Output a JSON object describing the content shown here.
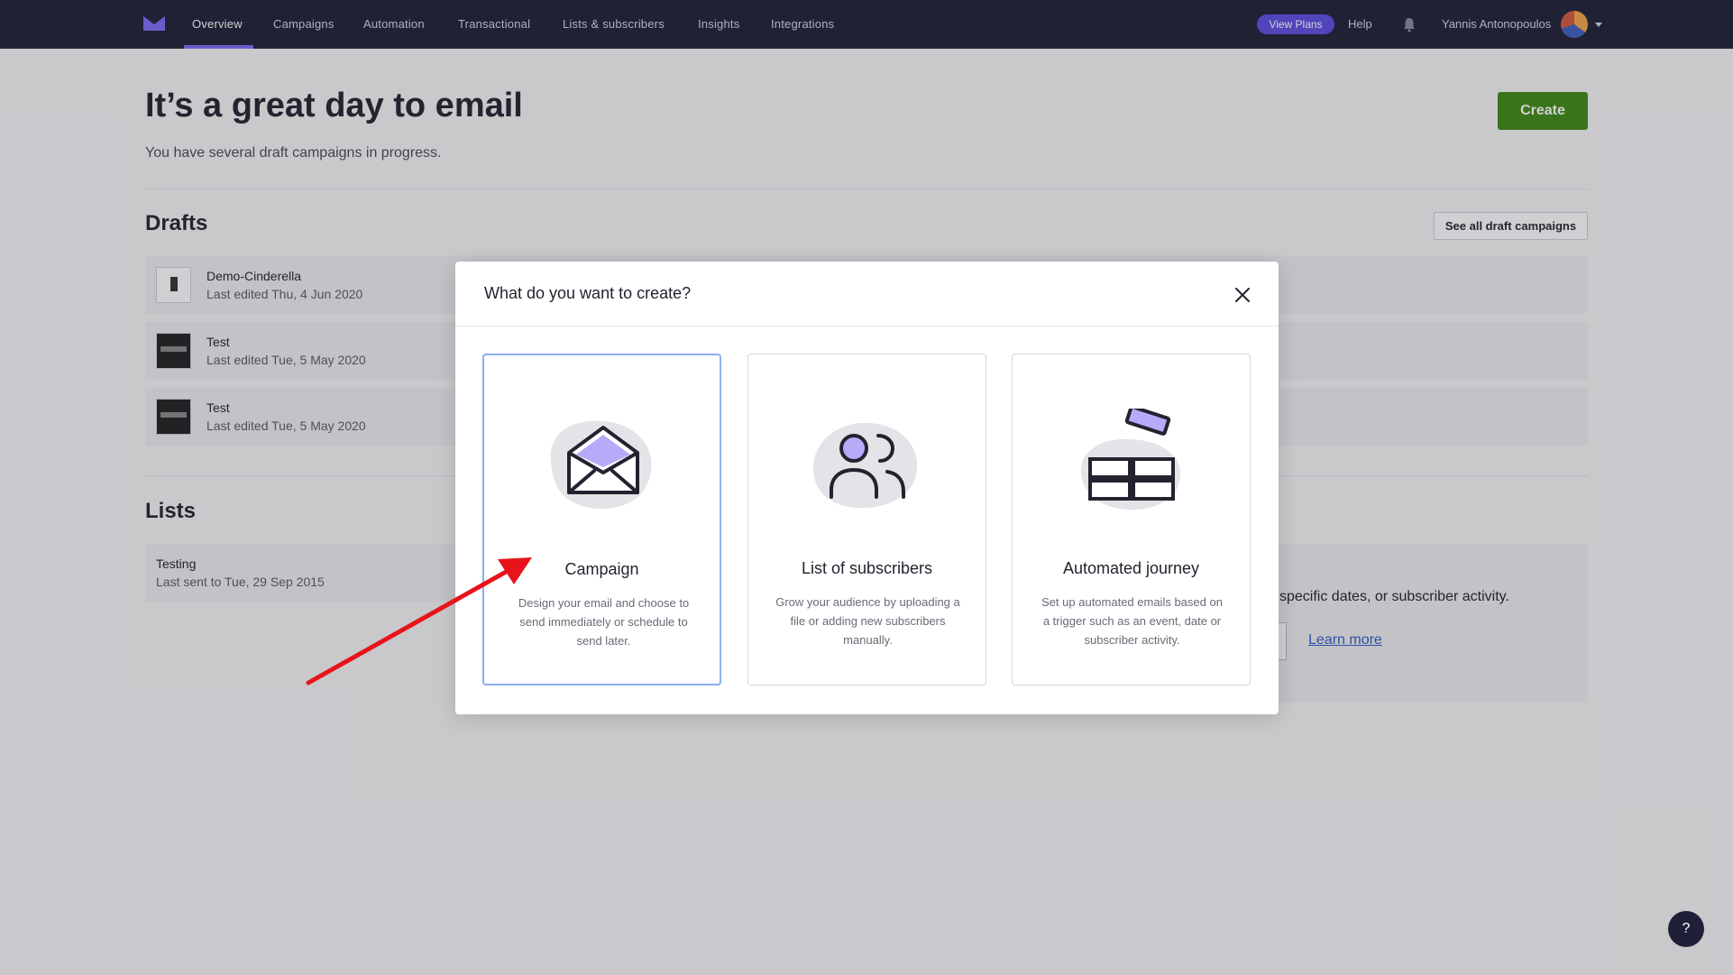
{
  "nav": {
    "items": [
      {
        "label": "Overview",
        "active": true
      },
      {
        "label": "Campaigns"
      },
      {
        "label": "Automation"
      },
      {
        "label": "Transactional"
      },
      {
        "label": "Lists & subscribers"
      },
      {
        "label": "Insights"
      },
      {
        "label": "Integrations"
      }
    ],
    "view_plans": "View Plans",
    "help": "Help",
    "bell_icon": "bell-icon",
    "user_name": "Yannis Antonopoulos",
    "accent_color": "#7b6cf6"
  },
  "page": {
    "title": "It’s a great day to email",
    "subtitle": "You have several draft campaigns in progress.",
    "create_label": "Create",
    "create_color": "#3f8a12"
  },
  "drafts": {
    "heading": "Drafts",
    "see_all": "See all draft campaigns",
    "rows": [
      {
        "title": "Demo-Cinderella",
        "subtitle": "Last edited Thu, 4 Jun 2020"
      },
      {
        "title": "Test",
        "subtitle": "Last edited Tue, 5 May 2020"
      },
      {
        "title": "Test",
        "subtitle": "Last edited Tue, 5 May 2020"
      }
    ]
  },
  "lists": {
    "heading": "Lists",
    "rows": [
      {
        "title": "Testing",
        "subtitle": "Last sent to Tue, 29 Sep 2015"
      }
    ],
    "promo_text": "specific dates, or subscriber activity.",
    "learn_more": "Learn more"
  },
  "modal": {
    "title": "What do you want to create?",
    "close_icon": "close-icon",
    "cards": [
      {
        "title": "Campaign",
        "description": "Design your email and choose to send immediately or schedule to send later.",
        "icon": "envelope-icon",
        "selected": true
      },
      {
        "title": "List of subscribers",
        "description": "Grow your audience by uploading a file or adding new subscribers manually.",
        "icon": "people-icon"
      },
      {
        "title": "Automated journey",
        "description": "Set up automated emails based on a trigger such as an event, date or subscriber activity.",
        "icon": "blocks-icon"
      }
    ]
  },
  "help_fab": "?"
}
